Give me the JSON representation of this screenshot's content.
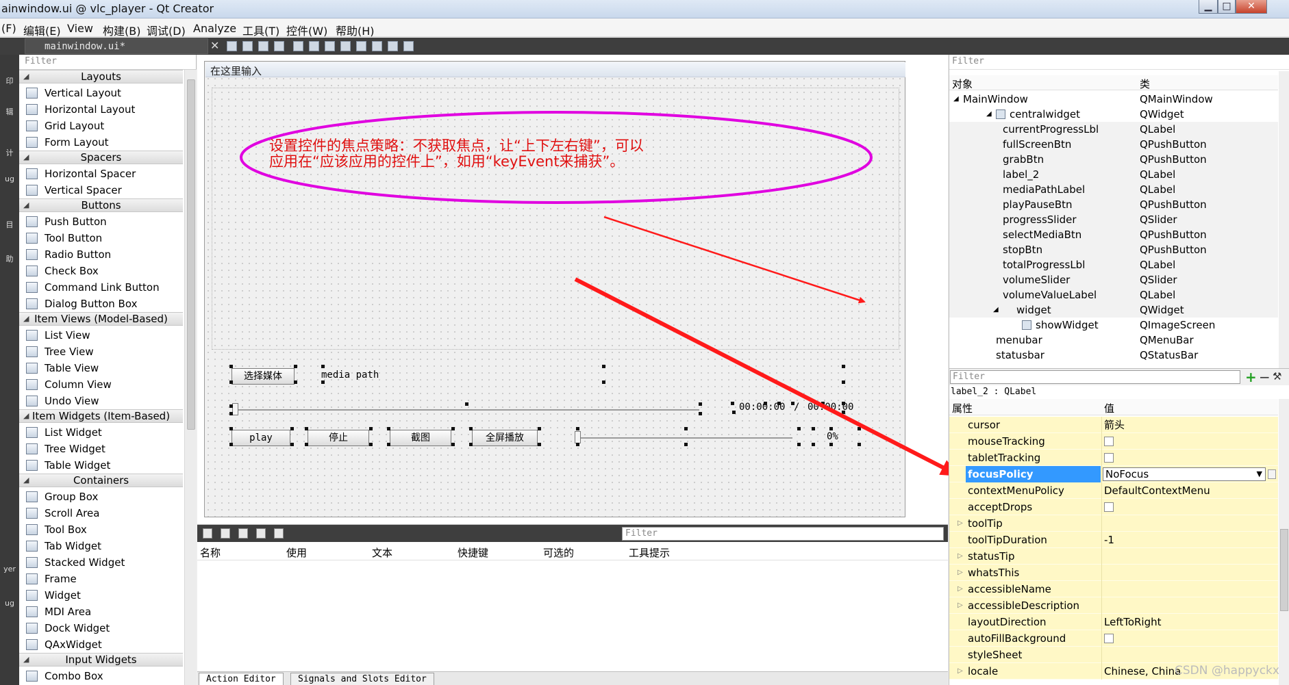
{
  "window": {
    "title": "ainwindow.ui @ vlc_player - Qt Creator",
    "buttons": {
      "minimize": "▁",
      "maximize": "□",
      "close": "✕"
    }
  },
  "menubar": [
    "(F)",
    "编辑(E)",
    "View",
    "构建(B)",
    "调试(D)",
    "Analyze",
    "工具(T)",
    "控件(W)",
    "帮助(H)"
  ],
  "tabbar": {
    "file_tab": "mainwindow.ui*",
    "close_glyph": "✕"
  },
  "modebar": [
    "印",
    "辑",
    "计",
    "ug",
    "目",
    "助",
    "yer",
    "ug"
  ],
  "widget_box": {
    "filter_placeholder": "Filter",
    "categories": [
      {
        "name": "Layouts",
        "items": [
          "Vertical Layout",
          "Horizontal Layout",
          "Grid Layout",
          "Form Layout"
        ]
      },
      {
        "name": "Spacers",
        "items": [
          "Horizontal Spacer",
          "Vertical Spacer"
        ]
      },
      {
        "name": "Buttons",
        "items": [
          "Push Button",
          "Tool Button",
          "Radio Button",
          "Check Box",
          "Command Link Button",
          "Dialog Button Box"
        ]
      },
      {
        "name": "Item Views (Model-Based)",
        "items": [
          "List View",
          "Tree View",
          "Table View",
          "Column View",
          "Undo View"
        ]
      },
      {
        "name": "Item Widgets (Item-Based)",
        "items": [
          "List Widget",
          "Tree Widget",
          "Table Widget"
        ]
      },
      {
        "name": "Containers",
        "items": [
          "Group Box",
          "Scroll Area",
          "Tool Box",
          "Tab Widget",
          "Stacked Widget",
          "Frame",
          "Widget",
          "MDI Area",
          "Dock Widget",
          "QAxWidget"
        ]
      },
      {
        "name": "Input Widgets",
        "items": [
          "Combo Box"
        ]
      }
    ]
  },
  "form": {
    "menubar_label": "在这里输入",
    "select_media_btn": "选择媒体",
    "media_path_label": "media path",
    "time_current": "00:00:00",
    "time_separator": "/",
    "time_total": "00:00:00",
    "play_btn": "play",
    "stop_btn": "停止",
    "grab_btn": "截图",
    "fullscreen_btn": "全屏播放",
    "volume_value": "0%",
    "annotation": {
      "line1": "设置控件的焦点策略：不获取焦点，让“上下左右键”，可以",
      "line2": "应用在“应该应用的控件上”，如用“keyEvent来捕获”。"
    },
    "annotation_color": "#e01010",
    "ellipse_color": "#e000e0",
    "arrow_color": "#ff1a1a"
  },
  "action_editor": {
    "filter_placeholder": "Filter",
    "columns": [
      "名称",
      "使用",
      "文本",
      "快捷键",
      "可选的",
      "工具提示"
    ],
    "tabs": [
      "Action Editor",
      "Signals and Slots Editor"
    ]
  },
  "object_inspector": {
    "filter_placeholder": "Filter",
    "headers": [
      "对象",
      "类"
    ],
    "rows": [
      {
        "name": "MainWindow",
        "class": "QMainWindow",
        "level": 0,
        "exp": "◢"
      },
      {
        "name": "centralwidget",
        "class": "QWidget",
        "level": 1,
        "exp": "◢"
      },
      {
        "name": "currentProgressLbl",
        "class": "QLabel",
        "level": 2,
        "exp": ""
      },
      {
        "name": "fullScreenBtn",
        "class": "QPushButton",
        "level": 2,
        "exp": ""
      },
      {
        "name": "grabBtn",
        "class": "QPushButton",
        "level": 2,
        "exp": ""
      },
      {
        "name": "label_2",
        "class": "QLabel",
        "level": 2,
        "exp": ""
      },
      {
        "name": "mediaPathLabel",
        "class": "QLabel",
        "level": 2,
        "exp": ""
      },
      {
        "name": "playPauseBtn",
        "class": "QPushButton",
        "level": 2,
        "exp": ""
      },
      {
        "name": "progressSlider",
        "class": "QSlider",
        "level": 2,
        "exp": ""
      },
      {
        "name": "selectMediaBtn",
        "class": "QPushButton",
        "level": 2,
        "exp": ""
      },
      {
        "name": "stopBtn",
        "class": "QPushButton",
        "level": 2,
        "exp": ""
      },
      {
        "name": "totalProgressLbl",
        "class": "QLabel",
        "level": 2,
        "exp": ""
      },
      {
        "name": "volumeSlider",
        "class": "QSlider",
        "level": 2,
        "exp": ""
      },
      {
        "name": "volumeValueLabel",
        "class": "QLabel",
        "level": 2,
        "exp": ""
      },
      {
        "name": "widget",
        "class": "QWidget",
        "level": 2,
        "exp": "◢"
      },
      {
        "name": "showWidget",
        "class": "QImageScreen",
        "level": 3,
        "exp": ""
      },
      {
        "name": "menubar",
        "class": "QMenuBar",
        "level": 1,
        "exp": ""
      },
      {
        "name": "statusbar",
        "class": "QStatusBar",
        "level": 1,
        "exp": ""
      }
    ]
  },
  "property_editor": {
    "filter_placeholder": "Filter",
    "object_label": "label_2 : QLabel",
    "headers": [
      "属性",
      "值"
    ],
    "rows": [
      {
        "name": "cursor",
        "value": "箭头",
        "type": "text",
        "expandable": false
      },
      {
        "name": "mouseTracking",
        "value": "",
        "type": "check",
        "expandable": false
      },
      {
        "name": "tabletTracking",
        "value": "",
        "type": "check",
        "expandable": false
      },
      {
        "name": "focusPolicy",
        "value": "NoFocus",
        "type": "combo",
        "expandable": false,
        "selected": true
      },
      {
        "name": "contextMenuPolicy",
        "value": "DefaultContextMenu",
        "type": "text",
        "expandable": false
      },
      {
        "name": "acceptDrops",
        "value": "",
        "type": "check",
        "expandable": false
      },
      {
        "name": "toolTip",
        "value": "",
        "type": "text",
        "expandable": true
      },
      {
        "name": "toolTipDuration",
        "value": "-1",
        "type": "text",
        "expandable": false
      },
      {
        "name": "statusTip",
        "value": "",
        "type": "text",
        "expandable": true
      },
      {
        "name": "whatsThis",
        "value": "",
        "type": "text",
        "expandable": true
      },
      {
        "name": "accessibleName",
        "value": "",
        "type": "text",
        "expandable": true
      },
      {
        "name": "accessibleDescription",
        "value": "",
        "type": "text",
        "expandable": true
      },
      {
        "name": "layoutDirection",
        "value": "LeftToRight",
        "type": "text",
        "expandable": false
      },
      {
        "name": "autoFillBackground",
        "value": "",
        "type": "check",
        "expandable": false
      },
      {
        "name": "styleSheet",
        "value": "",
        "type": "text",
        "expandable": false
      },
      {
        "name": "locale",
        "value": "Chinese, China",
        "type": "text",
        "expandable": true
      }
    ]
  },
  "watermark": "CSDN @happyckx"
}
